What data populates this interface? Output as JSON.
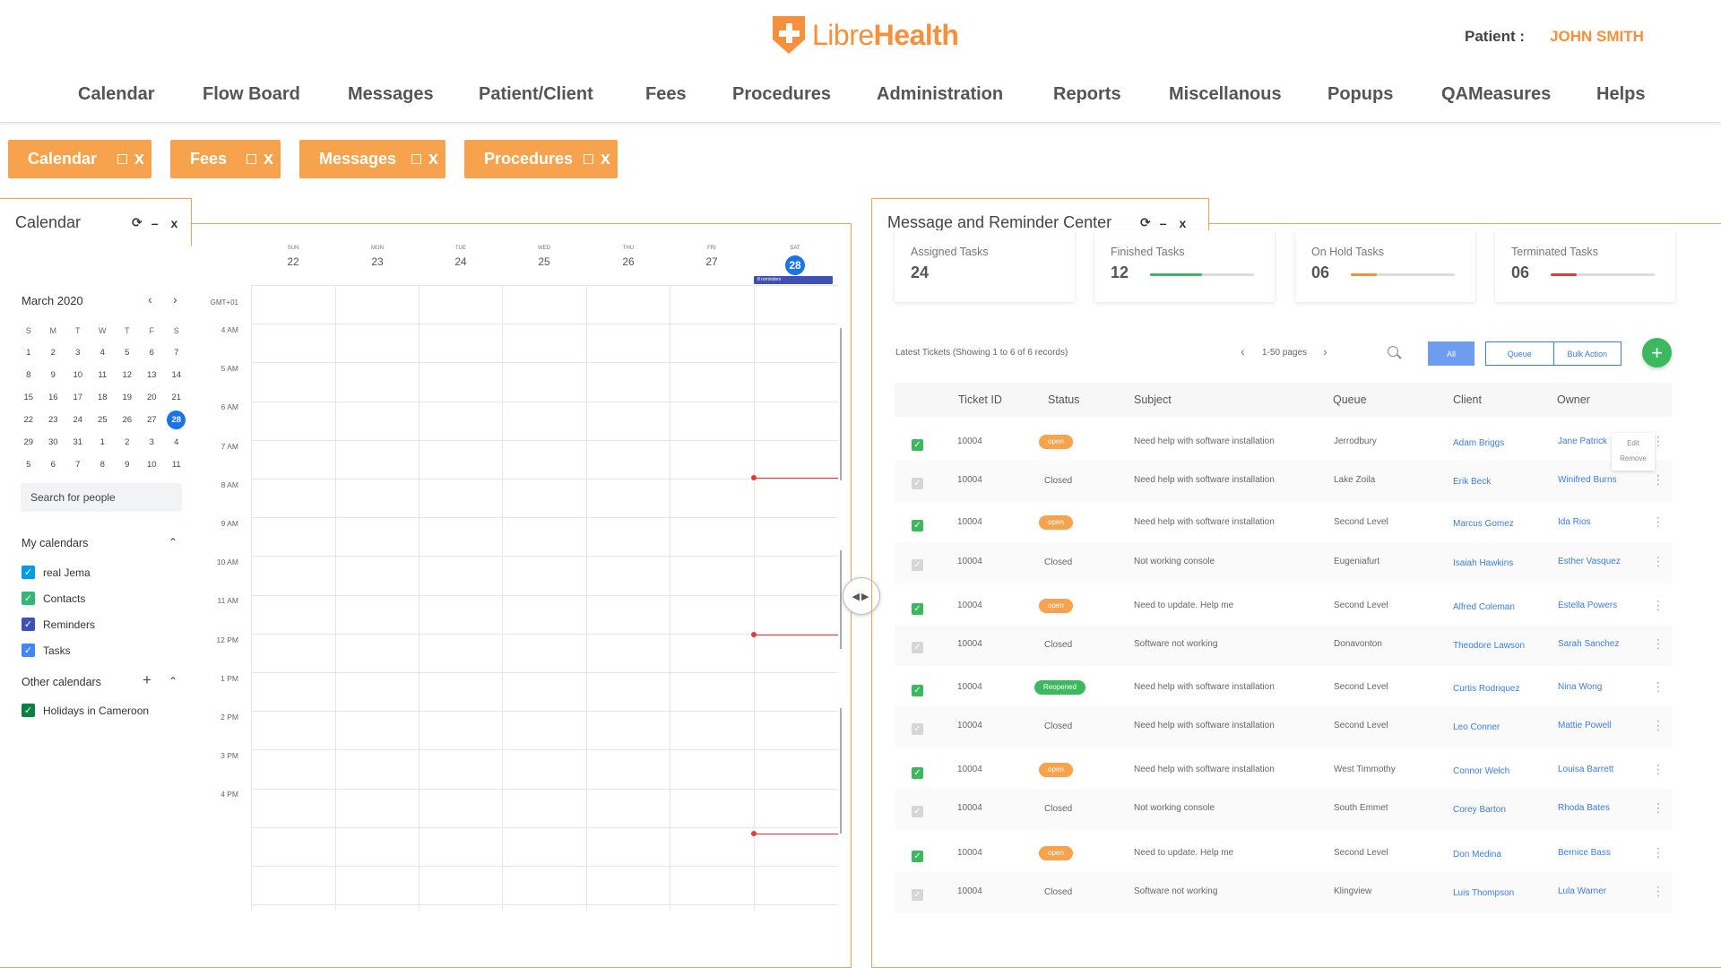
{
  "logo": {
    "text_light": "Libre",
    "text_bold": "Health"
  },
  "patient": {
    "label": "Patient :",
    "name": "JOHN SMITH"
  },
  "nav": [
    "Calendar",
    "Flow Board",
    "Messages",
    "Patient/Client",
    "Fees",
    "Procedures",
    "Administration",
    "Reports",
    "Miscellanous",
    "Popups",
    "QAMeasures",
    "Helps"
  ],
  "tabs": [
    {
      "label": "Calendar",
      "close": "x"
    },
    {
      "label": "Fees",
      "close": "x"
    },
    {
      "label": "Messages",
      "close": "x"
    },
    {
      "label": "Procedures",
      "close": "x"
    }
  ],
  "calendar_panel": {
    "title": "Calendar",
    "controls": {
      "refresh": "⟳",
      "minimize": "–",
      "close": "x"
    },
    "mini": {
      "month": "March 2020",
      "dow": [
        "S",
        "M",
        "T",
        "W",
        "T",
        "F",
        "S"
      ],
      "weeks": [
        [
          "1",
          "2",
          "3",
          "4",
          "5",
          "6",
          "7"
        ],
        [
          "8",
          "9",
          "10",
          "11",
          "12",
          "13",
          "14"
        ],
        [
          "15",
          "16",
          "17",
          "18",
          "19",
          "20",
          "21"
        ],
        [
          "22",
          "23",
          "24",
          "25",
          "26",
          "27",
          "28"
        ],
        [
          "29",
          "30",
          "31",
          "1",
          "2",
          "3",
          "4"
        ],
        [
          "5",
          "6",
          "7",
          "8",
          "9",
          "10",
          "11"
        ]
      ],
      "today": "28"
    },
    "search_placeholder": "Search for people",
    "my_calendars": {
      "label": "My calendars",
      "items": [
        {
          "label": "real Jema",
          "color": "#039be5"
        },
        {
          "label": "Contacts",
          "color": "#33b679"
        },
        {
          "label": "Reminders",
          "color": "#3f51b5"
        },
        {
          "label": "Tasks",
          "color": "#4285f4"
        }
      ]
    },
    "other_calendars": {
      "label": "Other calendars",
      "items": [
        {
          "label": "Holidays in Cameroon",
          "color": "#0b8043"
        }
      ]
    },
    "week": {
      "timezone": "GMT+01",
      "days": [
        {
          "dow": "SUN",
          "num": "22"
        },
        {
          "dow": "MON",
          "num": "23"
        },
        {
          "dow": "TUE",
          "num": "24"
        },
        {
          "dow": "WED",
          "num": "25"
        },
        {
          "dow": "THU",
          "num": "26"
        },
        {
          "dow": "FRI",
          "num": "27"
        },
        {
          "dow": "SAT",
          "num": "28"
        }
      ],
      "reminder_chip": "8 reminders",
      "times": [
        "4 AM",
        "5 AM",
        "6 AM",
        "7 AM",
        "8 AM",
        "9 AM",
        "10 AM",
        "11 AM",
        "12 PM",
        "1 PM",
        "2 PM",
        "3 PM",
        "4 PM"
      ]
    }
  },
  "message_panel": {
    "title": "Message and Reminder Center",
    "controls": {
      "refresh": "⟳",
      "minimize": "–",
      "close": "x"
    },
    "stats": [
      {
        "label": "Assigned Tasks",
        "value": "24",
        "progress": null,
        "color": null
      },
      {
        "label": "Finished Tasks",
        "value": "12",
        "progress": 0.5,
        "color": "#3cb95f"
      },
      {
        "label": "On Hold Tasks",
        "value": "06",
        "progress": 0.25,
        "color": "#f7903c"
      },
      {
        "label": "Terminated Tasks",
        "value": "06",
        "progress": 0.25,
        "color": "#e53935"
      }
    ],
    "latest": "Latest Tickets  (Showing 1 to 6 of 6 records)",
    "pages": "1-50 pages",
    "btn_all": "All",
    "btn_queue": "Queue",
    "btn_bulk": "Bulk Action",
    "btn_add": "+",
    "columns": [
      "Ticket ID",
      "Status",
      "Subject",
      "Queue",
      "Client",
      "Owner"
    ],
    "rows": [
      {
        "checked": true,
        "id": "10004",
        "status": "open",
        "subject": "Need help with software installation",
        "queue": "Jerrodbury",
        "client": "Adam Briggs",
        "owner": "Jane Patrick"
      },
      {
        "checked": false,
        "id": "10004",
        "status": "Closed",
        "subject": "Need help with software installation",
        "queue": "Lake Zoila",
        "client": "Erik Beck",
        "owner": "Winifred Burns"
      },
      {
        "checked": true,
        "id": "10004",
        "status": "open",
        "subject": "Need help with software installation",
        "queue": "Second Level",
        "client": "Marcus Gomez",
        "owner": "Ida Rios"
      },
      {
        "checked": false,
        "id": "10004",
        "status": "Closed",
        "subject": "Not working console",
        "queue": "Eugeniafurt",
        "client": "Isaiah Hawkins",
        "owner": "Esther Vasquez"
      },
      {
        "checked": true,
        "id": "10004",
        "status": "open",
        "subject": "Need to update. Help me",
        "queue": "Second Level",
        "client": "Alfred Coleman",
        "owner": "Estella Powers"
      },
      {
        "checked": false,
        "id": "10004",
        "status": "Closed",
        "subject": "Software not working",
        "queue": "Donavonton",
        "client": "Theodore Lawson",
        "owner": "Sarah Sanchez"
      },
      {
        "checked": true,
        "id": "10004",
        "status": "Reopened",
        "subject": "Need help with software installation",
        "queue": "Second Level",
        "client": "Curtis Rodriquez",
        "owner": "Nina Wong"
      },
      {
        "checked": false,
        "id": "10004",
        "status": "Closed",
        "subject": "Need help with software installation",
        "queue": "Second Level",
        "client": "Leo Conner",
        "owner": "Mattie Powell"
      },
      {
        "checked": true,
        "id": "10004",
        "status": "open",
        "subject": "Need help with software installation",
        "queue": "West Timmothy",
        "client": "Connor Welch",
        "owner": "Louisa Barrett"
      },
      {
        "checked": false,
        "id": "10004",
        "status": "Closed",
        "subject": "Not working console",
        "queue": "South Emmet",
        "client": "Corey Barton",
        "owner": "Rhoda Bates"
      },
      {
        "checked": true,
        "id": "10004",
        "status": "open",
        "subject": "Need to update. Help me",
        "queue": "Second Level",
        "client": "Don Medina",
        "owner": "Bernice Bass"
      },
      {
        "checked": false,
        "id": "10004",
        "status": "Closed",
        "subject": "Software not working",
        "queue": "Klingview",
        "client": "Luis Thompson",
        "owner": "Lula Warner"
      }
    ],
    "context_menu": {
      "edit": "Edit",
      "remove": "Remove"
    }
  },
  "colors": {
    "brand": "#f7903c",
    "tab": "#f7a24d",
    "today": "#1a73e8",
    "open": "#f7a24d",
    "reopened": "#3cb95f",
    "checked": "#3cb95f",
    "link": "#3b7de0"
  }
}
